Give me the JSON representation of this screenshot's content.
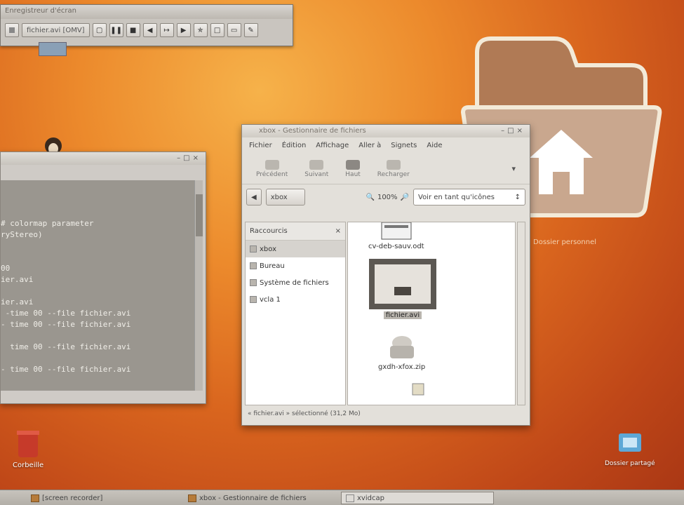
{
  "recorder": {
    "title": "Enregistreur d'écran",
    "input_label": "fichier.avi [OMV]",
    "buttons": [
      "record-icon",
      "pause-icon",
      "stop-icon",
      "frame-icon",
      "rewind-icon",
      "forward-icon",
      "settings-icon",
      "view-icon",
      "monitor-icon",
      "edit-icon"
    ]
  },
  "terminal": {
    "lines": [
      "",
      "",
      "",
      "# colormap parameter",
      "ryStereo)",
      "",
      "",
      "00",
      "ier.avi",
      "",
      "ier.avi",
      " -time 00 --file fichier.avi",
      "- time 00 --file fichier.avi",
      "",
      "  time 00 --file fichier.avi",
      "",
      "- time 00 --file fichier.avi"
    ]
  },
  "file_manager": {
    "title": "xbox - Gestionnaire de fichiers",
    "menu": [
      "Fichier",
      "Édition",
      "Affichage",
      "Aller à",
      "Signets",
      "Aide"
    ],
    "toolbar": [
      "Précédent",
      "Suivant",
      "Haut",
      "Recharger"
    ],
    "active_tool": "Haut",
    "location_button": "xbox",
    "zoom_label": "100%",
    "view_select": "Voir en tant qu'icônes",
    "sidebar_header": "Raccourcis",
    "sidebar_items": [
      "xbox",
      "Bureau",
      "Système de fichiers",
      "vcla 1"
    ],
    "files": [
      "cv-deb-sauv.odt",
      "fichier.avi",
      "gxdh-xfox.zip"
    ],
    "selected_file": "fichier.avi",
    "status": "« fichier.avi » sélectionné (31,2 Mo)"
  },
  "desktop": {
    "trash_label": "Corbeille",
    "folder_caption": "Dossier personnel",
    "network_label": "Dossier partagé"
  },
  "taskbar": {
    "tasks": [
      "[screen recorder]",
      "xbox - Gestionnaire de fichiers",
      "xvidcap"
    ],
    "active_task": 2
  }
}
